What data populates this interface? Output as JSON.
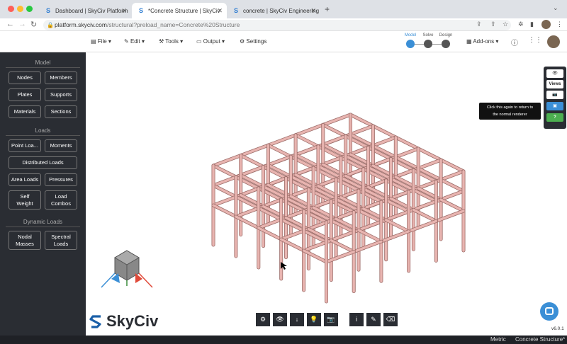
{
  "browser": {
    "tabs": [
      {
        "label": "Dashboard | SkyCiv Platform",
        "active": false
      },
      {
        "label": "*Concrete Structure | SkyCiv",
        "active": true
      },
      {
        "label": "concrete | SkyCiv Engineering",
        "active": false
      }
    ],
    "url_domain": "platform.skyciv.com",
    "url_path": "/structural?preload_name=Concrete%20Structure"
  },
  "menu": {
    "file": "File",
    "edit": "Edit",
    "tools": "Tools",
    "output": "Output",
    "settings": "Settings",
    "addons": "Add-ons"
  },
  "stages": {
    "model": "Model",
    "solve": "Solve",
    "design": "Design"
  },
  "sidebar": {
    "model_title": "Model",
    "loads_title": "Loads",
    "dynamic_title": "Dynamic Loads",
    "nodes": "Nodes",
    "members": "Members",
    "plates": "Plates",
    "supports": "Supports",
    "materials": "Materials",
    "sections": "Sections",
    "point_loads": "Point Loa...",
    "moments": "Moments",
    "distributed_loads": "Distributed Loads",
    "area_loads": "Area Loads",
    "pressures": "Pressures",
    "self_weight_1": "Self",
    "self_weight_2": "Weight",
    "load_combos_1": "Load",
    "load_combos_2": "Combos",
    "nodal_masses_1": "Nodal",
    "nodal_masses_2": "Masses",
    "spectral_loads_1": "Spectral",
    "spectral_loads_2": "Loads"
  },
  "right_toolbar": {
    "views": "Views"
  },
  "tooltip": {
    "line1": "Click this again to return to",
    "line2": "the normal renderer"
  },
  "logo": {
    "text": "SkyCiv"
  },
  "version": "v6.0.1",
  "status": {
    "units": "Metric",
    "project": "Concrete Structure*"
  },
  "colors": {
    "beam": "#e8b4b0",
    "beam_stroke": "#9d6e6a",
    "sidebar": "#2a2d33",
    "accent": "#3b8fd6"
  }
}
